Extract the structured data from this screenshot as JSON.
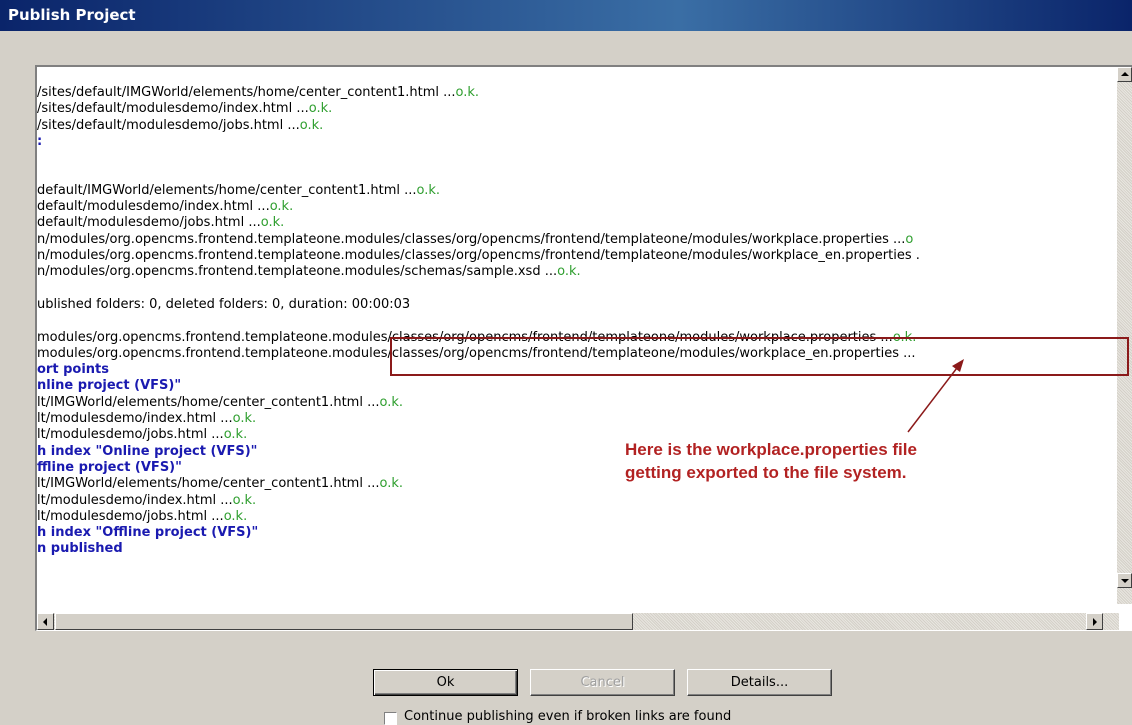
{
  "window": {
    "title": "Publish Project"
  },
  "log": [
    {
      "text": "/sites/default/IMGWorld/elements/home/center_content1.html ... ",
      "status": "o.k.",
      "style": "normal"
    },
    {
      "text": "/sites/default/modulesdemo/index.html ... ",
      "status": "o.k.",
      "style": "normal"
    },
    {
      "text": "/sites/default/modulesdemo/jobs.html ... ",
      "status": "o.k.",
      "style": "normal"
    },
    {
      "text": ":",
      "status": "",
      "style": "blue"
    },
    {
      "text": "",
      "status": "",
      "style": "normal"
    },
    {
      "text": "",
      "status": "",
      "style": "normal"
    },
    {
      "text": "default/IMGWorld/elements/home/center_content1.html ... ",
      "status": "o.k.",
      "style": "normal"
    },
    {
      "text": "default/modulesdemo/index.html ... ",
      "status": "o.k.",
      "style": "normal"
    },
    {
      "text": "default/modulesdemo/jobs.html ... ",
      "status": "o.k.",
      "style": "normal"
    },
    {
      "text": "n/modules/org.opencms.frontend.templateone.modules/classes/org/opencms/frontend/templateone/modules/workplace.properties ... ",
      "status": "o",
      "style": "normal"
    },
    {
      "text": "n/modules/org.opencms.frontend.templateone.modules/classes/org/opencms/frontend/templateone/modules/workplace_en.properties .",
      "status": "",
      "style": "normal"
    },
    {
      "text": "n/modules/org.opencms.frontend.templateone.modules/schemas/sample.xsd ... ",
      "status": "o.k.",
      "style": "normal"
    },
    {
      "text": "",
      "status": "",
      "style": "normal"
    },
    {
      "text": "ublished folders: 0, deleted folders: 0, duration: 00:00:03",
      "status": "",
      "style": "normal"
    },
    {
      "text": "",
      "status": "",
      "style": "normal"
    },
    {
      "text": "modules/org.opencms.frontend.templateone.modules/classes/org/opencms/frontend/templateone/modules/workplace.properties ... ",
      "status": "o.k.",
      "style": "normal"
    },
    {
      "text": "modules/org.opencms.frontend.templateone.modules/classes/org/opencms/frontend/templateone/modules/workplace_en.properties ...",
      "status": "",
      "style": "normal"
    },
    {
      "text": "ort points",
      "status": "",
      "style": "blue"
    },
    {
      "text": "nline project (VFS)\"",
      "status": "",
      "style": "blue"
    },
    {
      "text": "lt/IMGWorld/elements/home/center_content1.html ... ",
      "status": "o.k.",
      "style": "normal"
    },
    {
      "text": "lt/modulesdemo/index.html ... ",
      "status": "o.k.",
      "style": "normal"
    },
    {
      "text": "lt/modulesdemo/jobs.html ... ",
      "status": "o.k.",
      "style": "normal"
    },
    {
      "text": "h index \"Online project (VFS)\"",
      "status": "",
      "style": "blue"
    },
    {
      "text": "ffline project (VFS)\"",
      "status": "",
      "style": "blue"
    },
    {
      "text": "lt/IMGWorld/elements/home/center_content1.html ... ",
      "status": "o.k.",
      "style": "normal"
    },
    {
      "text": "lt/modulesdemo/index.html ... ",
      "status": "o.k.",
      "style": "normal"
    },
    {
      "text": "lt/modulesdemo/jobs.html ... ",
      "status": "o.k.",
      "style": "normal"
    },
    {
      "text": "h index \"Offline project (VFS)\"",
      "status": "",
      "style": "blue"
    },
    {
      "text": "n published",
      "status": "",
      "style": "blue"
    }
  ],
  "annotation": {
    "line1": "Here is the workplace.properties file",
    "line2": "getting exported to the file system.",
    "color": "#b22222"
  },
  "buttons": {
    "ok": "Ok",
    "cancel": "Cancel",
    "details": "Details..."
  },
  "checkbox": {
    "label": "Continue publishing even if broken links are found",
    "checked": false
  },
  "colors": {
    "ok_status": "#2e9e2e",
    "heading": "#1a1ab0",
    "highlight_box": "#8b1a1a"
  }
}
